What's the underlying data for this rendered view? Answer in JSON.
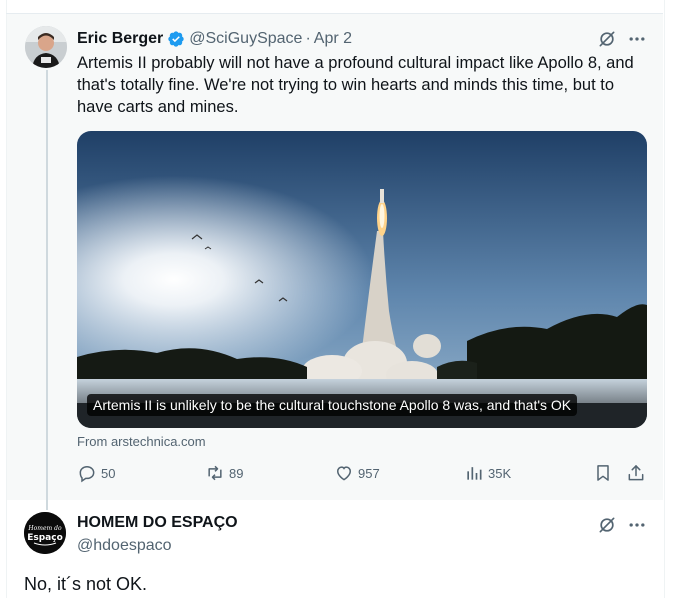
{
  "tweet": {
    "author_name": "Eric Berger",
    "handle": "@SciGuySpace",
    "separator": "·",
    "date": "Apr 2",
    "text": "Artemis II probably will not have a profound cultural impact like Apollo 8, and that's totally fine. We're not trying to win hearts and minds this time, but to have carts and mines.",
    "card_caption": "Artemis II is unlikely to be the cultural touchstone Apollo 8 was, and that's OK",
    "card_source": "From arstechnica.com",
    "stats": {
      "replies": "50",
      "reposts": "89",
      "likes": "957",
      "views": "35K"
    }
  },
  "reply": {
    "author_name": "HOMEM DO ESPAÇO",
    "handle": "@hdoespaco",
    "avatar_text_top": "Homem do",
    "avatar_text_bottom": "Espaço",
    "text": "No, it´s not OK."
  },
  "icons": {
    "verified": "verified-badge-icon",
    "grok": "grok-icon",
    "more": "more-icon",
    "reply": "reply-icon",
    "repost": "repost-icon",
    "like": "heart-icon",
    "views": "views-icon",
    "bookmark": "bookmark-icon",
    "share": "share-icon"
  },
  "colors": {
    "verified_blue": "#1d9bf0",
    "secondary_text": "#536471",
    "primary_text": "#0f1419",
    "highlight_bg": "#f7f9f9"
  }
}
